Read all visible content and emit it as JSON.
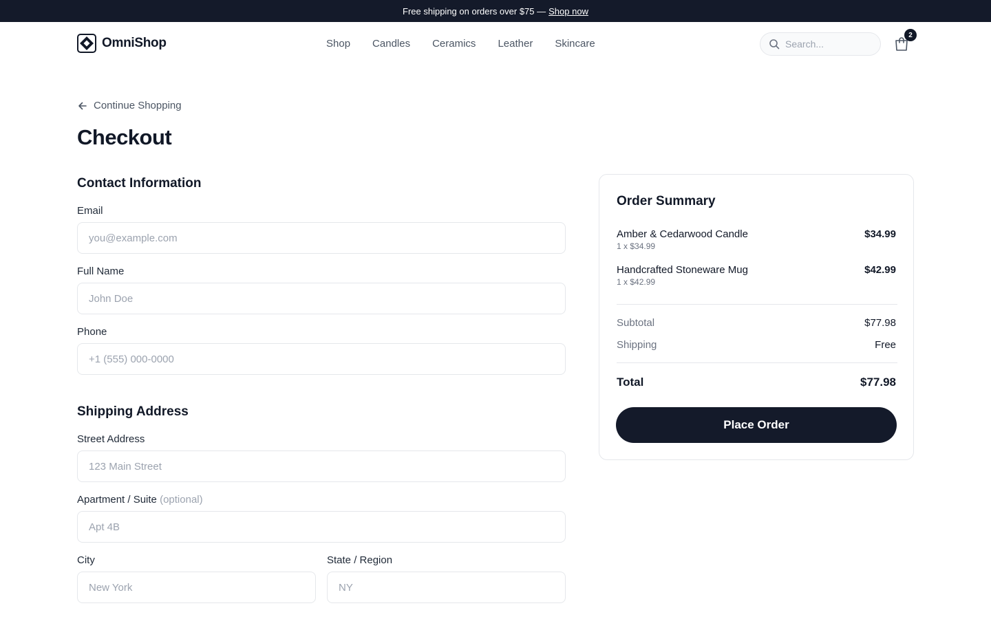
{
  "announcement": {
    "text": "Free shipping on orders over $75 —",
    "link": "Shop now"
  },
  "brand": {
    "name": "OmniShop"
  },
  "nav": [
    "Shop",
    "Candles",
    "Ceramics",
    "Leather",
    "Skincare"
  ],
  "search": {
    "placeholder": "Search...",
    "icon": "search-icon"
  },
  "cart": {
    "count": "2",
    "icon": "shopping-bag-icon"
  },
  "back_link": "Continue Shopping",
  "page_title": "Checkout",
  "contact": {
    "title": "Contact Information",
    "email": {
      "label": "Email",
      "placeholder": "you@example.com"
    },
    "full_name": {
      "label": "Full Name",
      "placeholder": "John Doe"
    },
    "phone": {
      "label": "Phone",
      "placeholder": "+1 (555) 000-0000"
    }
  },
  "shipping": {
    "title": "Shipping Address",
    "street": {
      "label": "Street Address",
      "placeholder": "123 Main Street"
    },
    "apartment": {
      "label": "Apartment / Suite",
      "optional": "(optional)",
      "placeholder": "Apt 4B"
    },
    "city": {
      "label": "City",
      "placeholder": "New York"
    },
    "state": {
      "label": "State / Region",
      "placeholder": "NY"
    }
  },
  "summary": {
    "title": "Order Summary",
    "items": [
      {
        "name": "Amber & Cedarwood Candle",
        "meta": "1 x $34.99",
        "price": "$34.99"
      },
      {
        "name": "Handcrafted Stoneware Mug",
        "meta": "1 x $42.99",
        "price": "$42.99"
      }
    ],
    "subtotal_label": "Subtotal",
    "subtotal": "$77.98",
    "shipping_label": "Shipping",
    "shipping": "Free",
    "total_label": "Total",
    "total": "$77.98",
    "cta": "Place Order"
  },
  "colors": {
    "dark": "#141a2a",
    "border": "#e5e7eb",
    "muted": "#6b7280"
  }
}
